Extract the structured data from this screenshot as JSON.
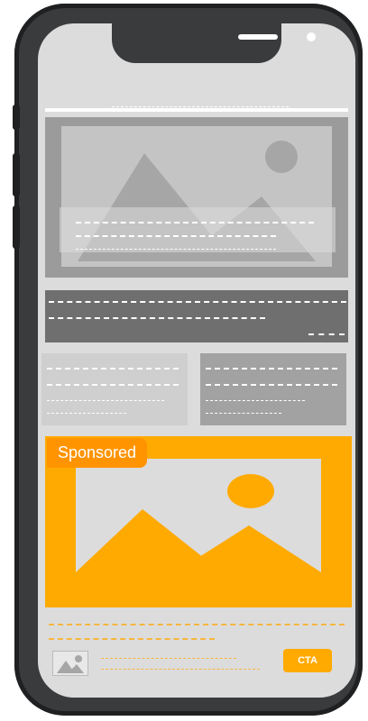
{
  "sponsored_ad": {
    "badge_label": "Sponsored",
    "cta_label": "CTA"
  },
  "icons": [
    "image-placeholder-icon",
    "mountain-icon",
    "sun-icon"
  ],
  "colors": {
    "device_frame": "#3a3b3d",
    "screen": "#dcdcdc",
    "ad_accent": "#ffaa00",
    "badge": "#ff9400"
  }
}
